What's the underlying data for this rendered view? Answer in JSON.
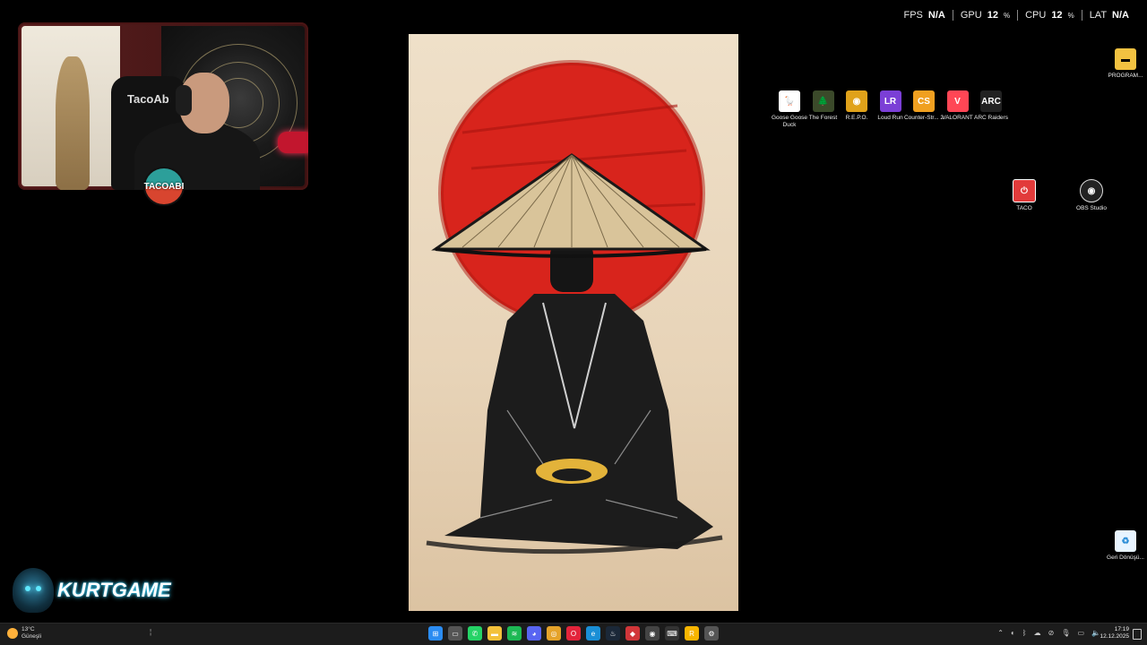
{
  "perf": {
    "fps_label": "FPS",
    "fps_value": "N/A",
    "gpu_label": "GPU",
    "gpu_value": "12",
    "gpu_unit": "%",
    "cpu_label": "CPU",
    "cpu_value": "12",
    "cpu_unit": "%",
    "lat_label": "LAT",
    "lat_value": "N/A"
  },
  "webcam": {
    "chair_text": "TacoAb",
    "badge_text": "TACOABI"
  },
  "desktop_icons": [
    {
      "label": "Goose Goose Duck",
      "icon": "goose-goose-duck-icon",
      "color": "#ffffff",
      "glyph": "🪿"
    },
    {
      "label": "The Forest",
      "icon": "the-forest-icon",
      "color": "#3b4a2a",
      "glyph": "🌲"
    },
    {
      "label": "R.E.P.O.",
      "icon": "repo-icon",
      "color": "#e0a21a",
      "glyph": "◉"
    },
    {
      "label": "Loud Run",
      "icon": "loud-run-icon",
      "color": "#7b3fd6",
      "glyph": "LR"
    },
    {
      "label": "Counter-Str... 2",
      "icon": "counter-strike-icon",
      "color": "#f0a020",
      "glyph": "CS"
    },
    {
      "label": "VALORANT",
      "icon": "valorant-icon",
      "color": "#ff4655",
      "glyph": "V"
    },
    {
      "label": "ARC Raiders",
      "icon": "arc-raiders-icon",
      "color": "#222222",
      "glyph": "ARC"
    }
  ],
  "right_icons": {
    "program": {
      "label": "PROGRAM...",
      "icon": "folder-icon"
    },
    "taco": {
      "label": "TACO",
      "icon": "power-icon"
    },
    "obs": {
      "label": "OBS Studio",
      "icon": "obs-icon"
    },
    "recycle": {
      "label": "Geri Dönüşü...",
      "icon": "recycle-bin-icon"
    }
  },
  "logo": {
    "text": "KURTGAME"
  },
  "taskbar": {
    "weather_temp": "13°C",
    "weather_desc": "Güneşli",
    "time": "17:19",
    "date": "12.12.2025",
    "apps": [
      {
        "icon": "start-icon",
        "color": "#2b8cf2",
        "glyph": "⊞"
      },
      {
        "icon": "task-view-icon",
        "color": "#555555",
        "glyph": "▭"
      },
      {
        "icon": "whatsapp-icon",
        "color": "#25d366",
        "glyph": "✆"
      },
      {
        "icon": "file-explorer-icon",
        "color": "#f3c13a",
        "glyph": "▬"
      },
      {
        "icon": "spotify-icon",
        "color": "#1db954",
        "glyph": "≋"
      },
      {
        "icon": "discord-icon",
        "color": "#5865f2",
        "glyph": "◕"
      },
      {
        "icon": "chrome-icon",
        "color": "#e5a32a",
        "glyph": "◎"
      },
      {
        "icon": "opera-icon",
        "color": "#e3243b",
        "glyph": "O"
      },
      {
        "icon": "edge-icon",
        "color": "#1a8fd6",
        "glyph": "e"
      },
      {
        "icon": "steam-icon",
        "color": "#1b2838",
        "glyph": "♨"
      },
      {
        "icon": "riot-icon",
        "color": "#d13639",
        "glyph": "◆"
      },
      {
        "icon": "obs-taskbar-icon",
        "color": "#444444",
        "glyph": "◉"
      },
      {
        "icon": "gamebar-icon",
        "color": "#333333",
        "glyph": "⌨"
      },
      {
        "icon": "rockstar-icon",
        "color": "#f7b500",
        "glyph": "R"
      },
      {
        "icon": "settings-icon",
        "color": "#555555",
        "glyph": "⚙"
      }
    ]
  }
}
